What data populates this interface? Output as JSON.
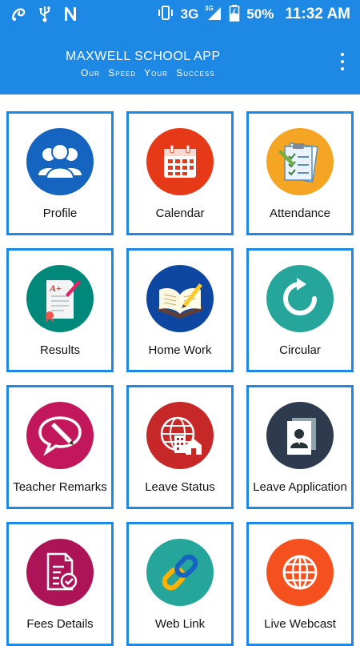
{
  "status_bar": {
    "network": "3G",
    "network_small": "3G",
    "battery": "50%",
    "time": "11:32 AM"
  },
  "app_bar": {
    "title": "MAXWELL SCHOOL APP",
    "subtitle": "Our Speed  Your Success",
    "menu_icon": "more-vert-icon"
  },
  "tiles": [
    {
      "label": "Profile",
      "icon": "profile-icon",
      "color": "#1565c0"
    },
    {
      "label": "Calendar",
      "icon": "calendar-icon",
      "color": "#e53917"
    },
    {
      "label": "Attendance",
      "icon": "attendance-icon",
      "color": "#f5a524"
    },
    {
      "label": "Results",
      "icon": "results-icon",
      "color": "#00897b"
    },
    {
      "label": "Home Work",
      "icon": "homework-icon",
      "color": "#0d47a1"
    },
    {
      "label": "Circular",
      "icon": "circular-icon",
      "color": "#26a69a"
    },
    {
      "label": "Teacher Remarks",
      "icon": "remarks-icon",
      "color": "#c2185b"
    },
    {
      "label": "Leave Status",
      "icon": "leave-status-icon",
      "color": "#c62828"
    },
    {
      "label": "Leave Application",
      "icon": "leave-application-icon",
      "color": "#2e3b4e"
    },
    {
      "label": "Fees Details",
      "icon": "fees-icon",
      "color": "#ad1457"
    },
    {
      "label": "Web Link",
      "icon": "link-icon",
      "color": "#26a69a"
    },
    {
      "label": "Live Webcast",
      "icon": "globe-icon",
      "color": "#f4511e"
    }
  ]
}
